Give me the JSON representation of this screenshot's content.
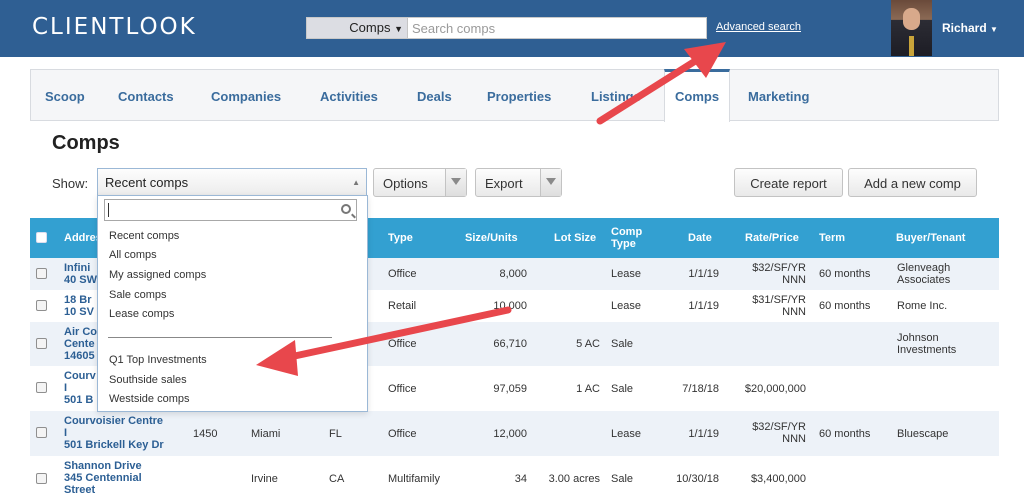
{
  "header": {
    "logo": "CLIENTLOOK",
    "search_scope": "Comps",
    "search_placeholder": "Search comps",
    "advanced_search": "Advanced search",
    "user_name": "Richard"
  },
  "tabs": [
    "Scoop",
    "Contacts",
    "Companies",
    "Activities",
    "Deals",
    "Properties",
    "Listings",
    "Comps",
    "Marketing"
  ],
  "page": {
    "title": "Comps",
    "show_label": "Show:",
    "selected_view": "Recent comps",
    "options_label": "Options",
    "export_label": "Export",
    "create_report_label": "Create report",
    "add_comp_label": "Add a new comp"
  },
  "dropdown": {
    "items": [
      "Recent comps",
      "All comps",
      "My assigned comps",
      "Sale comps",
      "Lease comps"
    ],
    "saved": [
      "Q1 Top Investments",
      "Southside sales",
      "Westside comps"
    ]
  },
  "table": {
    "headers": {
      "address": "Address",
      "type": "Type",
      "size": "Size/Units",
      "lot": "Lot Size",
      "comp_type_1": "Comp",
      "comp_type_2": "Type",
      "date": "Date",
      "rate": "Rate/Price",
      "term": "Term",
      "buyer": "Buyer/Tenant"
    },
    "rows": [
      {
        "addr": [
          "Infini",
          "40 SW"
        ],
        "suite": "",
        "city": "",
        "state": "",
        "type": "Office",
        "size": "8,000",
        "lot": "",
        "comp": "Lease",
        "date": "1/1/19",
        "rate": [
          "$32/SF/YR",
          "NNN"
        ],
        "term": "60 months",
        "buyer": [
          "Glenveagh",
          "Associates"
        ]
      },
      {
        "addr": [
          "18 Br",
          "10 SV"
        ],
        "suite": "",
        "city": "",
        "state": "",
        "type": "Retail",
        "size": "10,000",
        "lot": "",
        "comp": "Lease",
        "date": "1/1/19",
        "rate": [
          "$31/SF/YR",
          "NNN"
        ],
        "term": "60 months",
        "buyer": [
          "Rome Inc."
        ]
      },
      {
        "addr": [
          "Air Co",
          "Cente",
          "14605"
        ],
        "suite": "",
        "city": "",
        "state": "",
        "type": "Office",
        "size": "66,710",
        "lot": "5 AC",
        "comp": "Sale",
        "date": "",
        "rate": [],
        "term": "",
        "buyer": [
          "Johnson",
          "Investments"
        ]
      },
      {
        "addr": [
          "Courv",
          "I",
          "501 B"
        ],
        "suite": "",
        "city": "",
        "state": "",
        "type": "Office",
        "size": "97,059",
        "lot": "1 AC",
        "comp": "Sale",
        "date": "7/18/18",
        "rate": [
          "$20,000,000"
        ],
        "term": "",
        "buyer": []
      },
      {
        "addr": [
          "Courvoisier Centre",
          "I",
          "501 Brickell Key Dr"
        ],
        "suite": "1450",
        "city": "Miami",
        "state": "FL",
        "type": "Office",
        "size": "12,000",
        "lot": "",
        "comp": "Lease",
        "date": "1/1/19",
        "rate": [
          "$32/SF/YR",
          "NNN"
        ],
        "term": "60 months",
        "buyer": [
          "Bluescape"
        ]
      },
      {
        "addr": [
          "Shannon Drive",
          "345 Centennial",
          "Street"
        ],
        "suite": "",
        "city": "Irvine",
        "state": "CA",
        "type": "Multifamily",
        "size": "34",
        "lot": "3.00 acres",
        "comp": "Sale",
        "date": "10/30/18",
        "rate": [
          "$3,400,000"
        ],
        "term": "",
        "buyer": []
      }
    ]
  },
  "colors": {
    "header_bg": "#2f5f93",
    "table_header_bg": "#33a0d1",
    "link": "#2c5f94",
    "annotation_arrow": "#e8474c"
  }
}
